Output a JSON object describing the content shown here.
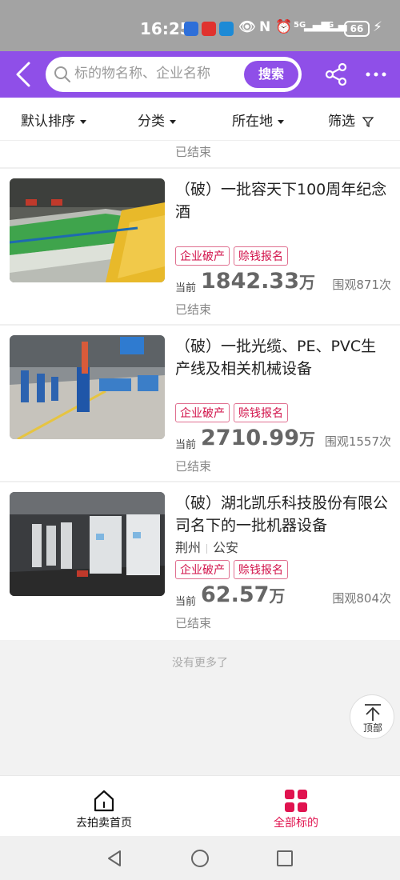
{
  "status_bar": {
    "time": "16:25",
    "battery": "66",
    "network_5g": "5G",
    "network_4g": "4G"
  },
  "header": {
    "search_placeholder": "标的物名称、企业名称",
    "search_button": "搜索",
    "icons": [
      "back-arrow-icon",
      "search-icon",
      "share-icon",
      "more-icon"
    ]
  },
  "filters": {
    "sort": "默认排序",
    "category": "分类",
    "location": "所在地",
    "screen": "筛选"
  },
  "previous_item_status": "已结束",
  "listings": [
    {
      "title": "（破）一批容天下100周年纪念酒",
      "location": null,
      "tags": [
        "企业破产",
        "赊钱报名"
      ],
      "price_label": "当前",
      "price": "1842.33",
      "price_unit": "万",
      "views": "围观871次",
      "status": "已结束"
    },
    {
      "title": "（破）一批光缆、PE、PVC生产线及相关机械设备",
      "location": null,
      "tags": [
        "企业破产",
        "赊钱报名"
      ],
      "price_label": "当前",
      "price": "2710.99",
      "price_unit": "万",
      "views": "围观1557次",
      "status": "已结束"
    },
    {
      "title": "（破）湖北凯乐科技股份有限公司名下的一批机器设备",
      "location": {
        "city": "荆州",
        "district": "公安"
      },
      "tags": [
        "企业破产",
        "赊钱报名"
      ],
      "price_label": "当前",
      "price": "62.57",
      "price_unit": "万",
      "views": "围观804次",
      "status": "已结束"
    }
  ],
  "footer": {
    "no_more": "没有更多了",
    "back_to_top": "顶部"
  },
  "tab_bar": {
    "home": "去拍卖首页",
    "all": "全部标的"
  },
  "colors": {
    "header_purple": "#8f4fe8",
    "tag_red": "#d2124a",
    "active_tab": "#e0134f"
  }
}
